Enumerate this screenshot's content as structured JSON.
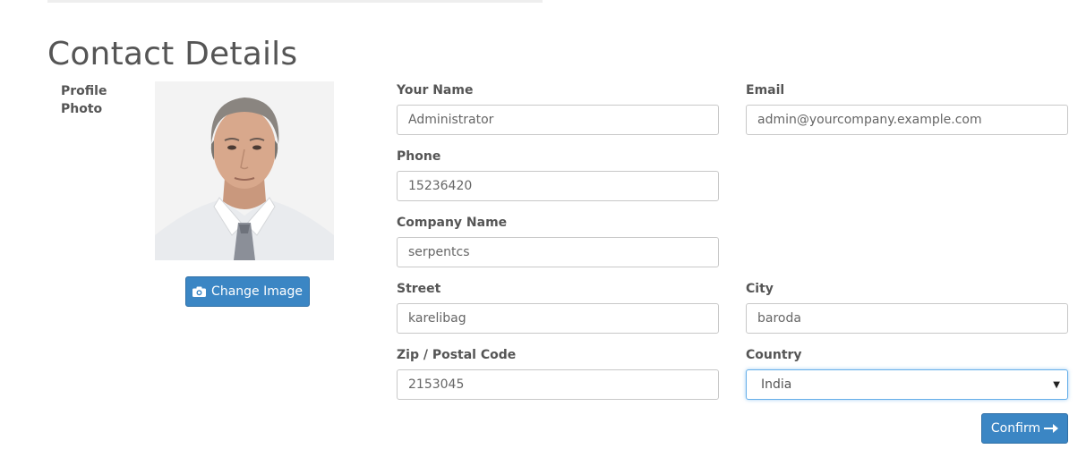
{
  "page": {
    "title": "Contact Details"
  },
  "profile": {
    "photo_label": "Profile Photo",
    "change_image_label": "Change Image",
    "change_image_icon": "camera-icon"
  },
  "form": {
    "name": {
      "label": "Your Name",
      "value": "Administrator"
    },
    "email": {
      "label": "Email",
      "value": "admin@yourcompany.example.com"
    },
    "phone": {
      "label": "Phone",
      "value": "15236420"
    },
    "company": {
      "label": "Company Name",
      "value": "serpentcs"
    },
    "street": {
      "label": "Street",
      "value": "karelibag"
    },
    "city": {
      "label": "City",
      "value": "baroda"
    },
    "zip": {
      "label": "Zip / Postal Code",
      "value": "2153045"
    },
    "country": {
      "label": "Country",
      "value": "India"
    }
  },
  "actions": {
    "confirm_label": "Confirm",
    "confirm_icon": "arrow-right-icon"
  },
  "colors": {
    "primary_button": "#3b86c4",
    "focus_border": "#66afe9"
  }
}
